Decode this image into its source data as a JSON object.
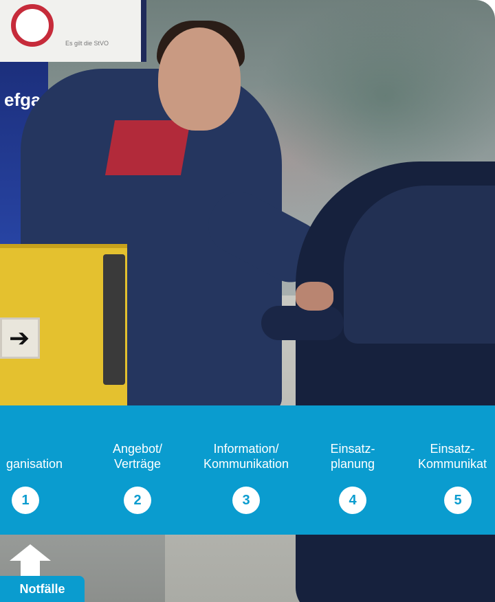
{
  "nav": {
    "items": [
      {
        "line1": "",
        "line2": "ganisation",
        "number": "1"
      },
      {
        "line1": "Angebot/",
        "line2": "Verträge",
        "number": "2"
      },
      {
        "line1": "Information/",
        "line2": "Kommunikation",
        "number": "3"
      },
      {
        "line1": "Einsatz-",
        "line2": "planung",
        "number": "4"
      },
      {
        "line1": "Einsatz-",
        "line2": "Kommunikat",
        "number": "5"
      }
    ]
  },
  "emergency": {
    "label": "Notfälle"
  },
  "photo": {
    "pillar_text": "efga",
    "sign_text": "Es gilt die StVO"
  },
  "colors": {
    "accent": "#0a9ccf",
    "text_on_accent": "#ffffff"
  }
}
